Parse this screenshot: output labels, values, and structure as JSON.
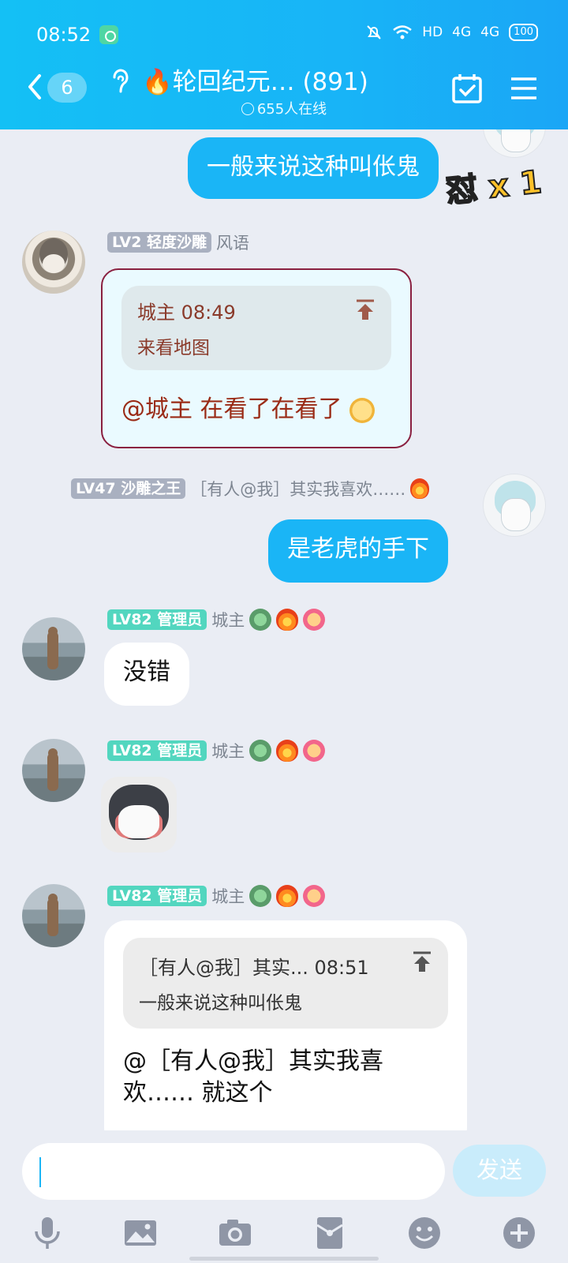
{
  "status_bar": {
    "time": "08:52",
    "net": "HD",
    "sig1": "4G",
    "sig2": "4G",
    "battery": "100"
  },
  "header": {
    "unread_count": "6",
    "group_title": "🔥轮回纪元…  (891)",
    "online_text": "655人在线"
  },
  "sticker_badge": "怼 x 1",
  "messages": {
    "m1": {
      "text": "一般来说这种叫伥鬼"
    },
    "m2": {
      "level": "LV2 轻度沙雕",
      "name": "风语",
      "quote_meta": "城主 08:49",
      "quote_text": "来看地图",
      "body": "@城主 在看了在看了"
    },
    "m3": {
      "level": "LV47 沙雕之王",
      "name": "［有人@我］其实我喜欢……",
      "text": "是老虎的手下"
    },
    "m4": {
      "level": "LV82 管理员",
      "name": "城主",
      "text": "没错"
    },
    "m5": {
      "level": "LV82 管理员",
      "name": "城主"
    },
    "m6": {
      "level": "LV82 管理员",
      "name": "城主",
      "quote_meta": "［有人@我］其实... 08:51",
      "quote_text": "一般来说这种叫伥鬼",
      "body_line1": "@［有人@我］其实我喜",
      "body_line2": "欢…… 就这个"
    }
  },
  "input": {
    "placeholder": "",
    "send_label": "发送"
  },
  "icons": [
    "microphone-icon",
    "image-icon",
    "camera-icon",
    "red-packet-icon",
    "emoji-icon",
    "plus-icon"
  ]
}
